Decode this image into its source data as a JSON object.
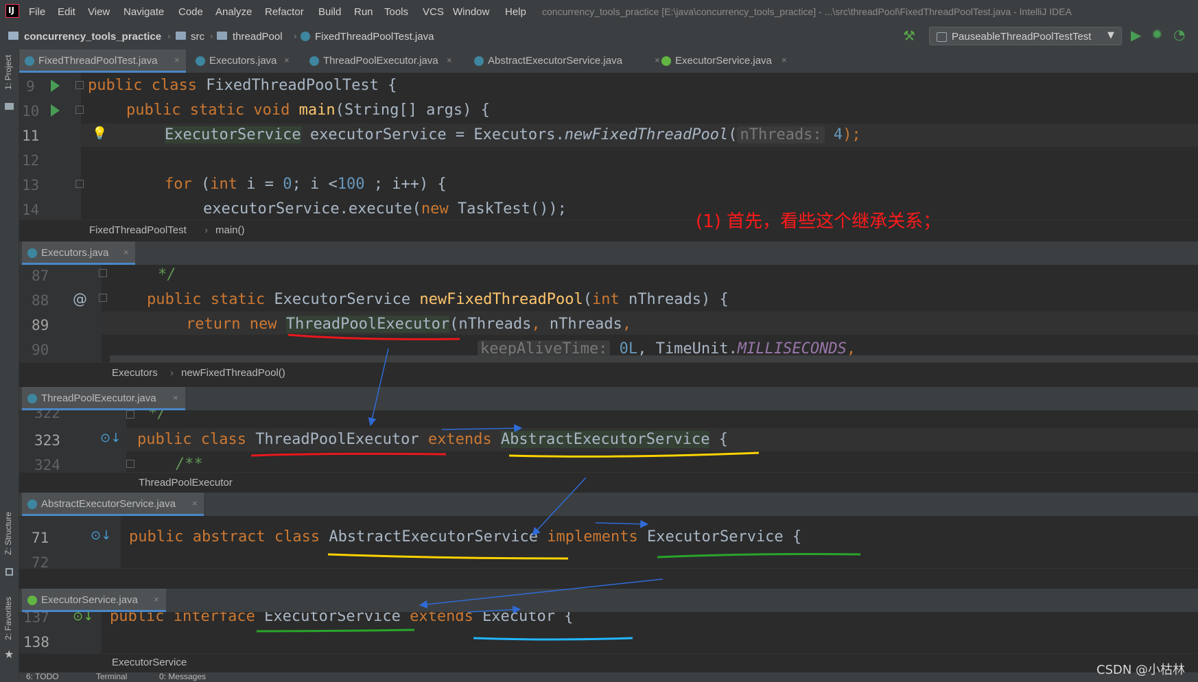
{
  "menu": {
    "items": [
      "File",
      "Edit",
      "View",
      "Navigate",
      "Code",
      "Analyze",
      "Refactor",
      "Build",
      "Run",
      "Tools",
      "VCS",
      "Window",
      "Help"
    ],
    "window_title": "concurrency_tools_practice [E:\\java\\concurrency_tools_practice] - ...\\src\\threadPool\\FixedThreadPoolTest.java - IntelliJ IDEA"
  },
  "nav": {
    "project": "concurrency_tools_practice",
    "folder1": "src",
    "folder2": "threadPool",
    "file": "FixedThreadPoolTest.java",
    "run_config": "PauseableThreadPoolTestTest"
  },
  "side": {
    "project": "1: Project",
    "structure": "Z: Structure",
    "favorites": "2: Favorites"
  },
  "tabs": [
    {
      "label": "FixedThreadPoolTest.java"
    },
    {
      "label": "Executors.java"
    },
    {
      "label": "ThreadPoolExecutor.java"
    },
    {
      "label": "AbstractExecutorService.java"
    },
    {
      "label": "ExecutorService.java"
    }
  ],
  "pane1": {
    "lines": [
      "9",
      "10",
      "11",
      "12",
      "13",
      "14"
    ],
    "code": {
      "l9a": "public class ",
      "l9b": "FixedThreadPoolTest {",
      "l10a": "public static void ",
      "l10b": "main",
      "l10c": "(String[] args) {",
      "l11a": "ExecutorService",
      "l11b": " executorService = Executors.",
      "l11c": "newFixedThreadPool",
      "l11d": "(",
      "l11hint": "nThreads:",
      "l11e": " 4",
      "l11f": ");",
      "l13a": "for",
      "l13b": " (",
      "l13c": "int",
      "l13d": " i = ",
      "l13e": "0",
      "l13f": "; i <",
      "l13g": "100",
      "l13h": " ; i++) {",
      "l14a": "executorService.execute(",
      "l14b": "new",
      "l14c": " TaskTest());"
    },
    "crumb1": "FixedThreadPoolTest",
    "crumb2": "main()"
  },
  "annotation": "(1) 首先，看些这个继承关系；",
  "pane2": {
    "tab": "Executors.java",
    "lines": [
      "87",
      "88",
      "89",
      "90"
    ],
    "code": {
      "l87": "*/",
      "l88a": "public static ",
      "l88b": "ExecutorService ",
      "l88c": "newFixedThreadPool",
      "l88d": "(",
      "l88e": "int",
      "l88f": " nThreads) {",
      "l89a": "return new ",
      "l89b": "ThreadPoolExecutor",
      "l89c": "(nThreads",
      "l89d": ", ",
      "l89e": "nThreads",
      "l89f": ",",
      "l90hint": "keepAliveTime:",
      "l90a": " 0L",
      "l90b": ", TimeUnit.",
      "l90c": "MILLISECONDS",
      "l90d": ","
    },
    "crumb1": "Executors",
    "crumb2": "newFixedThreadPool()"
  },
  "pane3": {
    "tab": "ThreadPoolExecutor.java",
    "lines": [
      "322",
      "323",
      "324"
    ],
    "code": {
      "l322": "*/",
      "l323a": "public class ",
      "l323b": "ThreadPoolExecutor ",
      "l323c": "extends ",
      "l323d": "AbstractExecutorService",
      "l323e": " {",
      "l324": "/**"
    },
    "crumb1": "ThreadPoolExecutor"
  },
  "pane4": {
    "tab": "AbstractExecutorService.java",
    "lines": [
      "71",
      "72"
    ],
    "code": {
      "l71a": "public abstract class ",
      "l71b": "AbstractExecutorService ",
      "l71c": "implements ",
      "l71d": "ExecutorService {"
    }
  },
  "pane5": {
    "tab": "ExecutorService.java",
    "lines": [
      "137",
      "138"
    ],
    "code": {
      "l137a": "public interface ",
      "l137b": "ExecutorService ",
      "l137c": "extends ",
      "l137d": "Executor {"
    },
    "crumb1": "ExecutorService"
  },
  "bottom": {
    "todo": "6: TODO",
    "terminal": "Terminal",
    "messages": "0: Messages"
  },
  "watermark": "CSDN @小枯林",
  "colors": {
    "annotation": "#ff1a1a",
    "underline_red": "#e8181d",
    "underline_yellow": "#ffd400",
    "underline_green": "#2aa52a",
    "underline_cyan": "#22b7ff",
    "arrow_blue": "#2f6bd8"
  }
}
